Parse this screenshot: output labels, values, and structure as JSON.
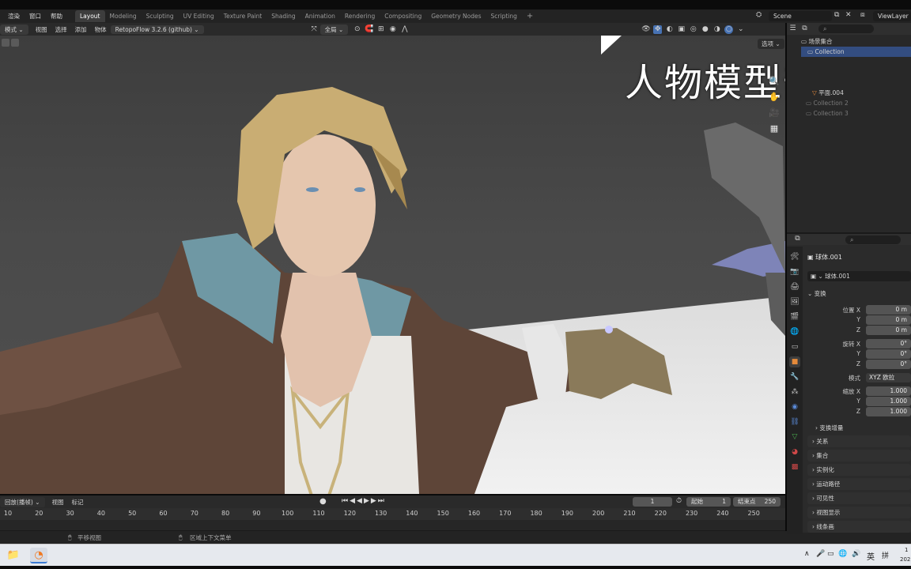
{
  "menu": {
    "items": [
      "渲染",
      "窗口",
      "帮助"
    ]
  },
  "workspaces": [
    "Layout",
    "Modeling",
    "Sculpting",
    "UV Editing",
    "Texture Paint",
    "Shading",
    "Animation",
    "Rendering",
    "Compositing",
    "Geometry Nodes",
    "Scripting"
  ],
  "workspace_add": "+",
  "scene": {
    "name": "Scene",
    "view_layer": "ViewLayer"
  },
  "viewport_header": {
    "mode": "模式",
    "menus": [
      "视图",
      "选择",
      "添加",
      "物体"
    ],
    "addon": "RetopoFlow 3.2.6 (github)",
    "transform": "全局",
    "options": "选项"
  },
  "overlay_text": "人物模型部分",
  "outliner": {
    "search_placeholder": "",
    "rows": [
      {
        "label": "场景集合",
        "dim": false
      },
      {
        "label": "Collection",
        "dim": false,
        "selected": true
      },
      {
        "label": "平面.004",
        "dim": false
      },
      {
        "label": "Collection 2",
        "dim": true
      },
      {
        "label": "Collection 3",
        "dim": true
      }
    ]
  },
  "properties": {
    "object_name": "球体.001",
    "data_name": "球体.001",
    "transform_section": "变换",
    "location_label": "位置 X",
    "rotation_label": "旋转 X",
    "scale_label": "缩放 X",
    "axis_y": "Y",
    "axis_z": "Z",
    "location": [
      "0 m",
      "0 m",
      "0 m"
    ],
    "rotation": [
      "0°",
      "0°",
      "0°"
    ],
    "mode_label": "模式",
    "rotation_mode": "XYZ 欧拉",
    "scale": [
      "1.000",
      "1.000",
      "1.000"
    ],
    "delta_transform": "变换增量",
    "panels": [
      "关系",
      "集合",
      "实例化",
      "运动路径",
      "可见性",
      "视图显示",
      "线条画"
    ]
  },
  "timeline": {
    "mode": "回放(播帧)",
    "menus": [
      "视图",
      "标记"
    ],
    "current_frame": "1",
    "start_label": "起始",
    "start": "1",
    "end_label": "结束点",
    "end": "250",
    "ticks": [
      10,
      20,
      30,
      40,
      50,
      60,
      70,
      80,
      90,
      100,
      110,
      120,
      130,
      140,
      150,
      160,
      170,
      180,
      190,
      200,
      210,
      220,
      230,
      240,
      250
    ]
  },
  "statusbar": {
    "left": "平移视图",
    "middle": "区域上下文菜单"
  },
  "taskbar": {
    "ime": "英",
    "clock_top": "1",
    "clock_bottom": "202"
  }
}
